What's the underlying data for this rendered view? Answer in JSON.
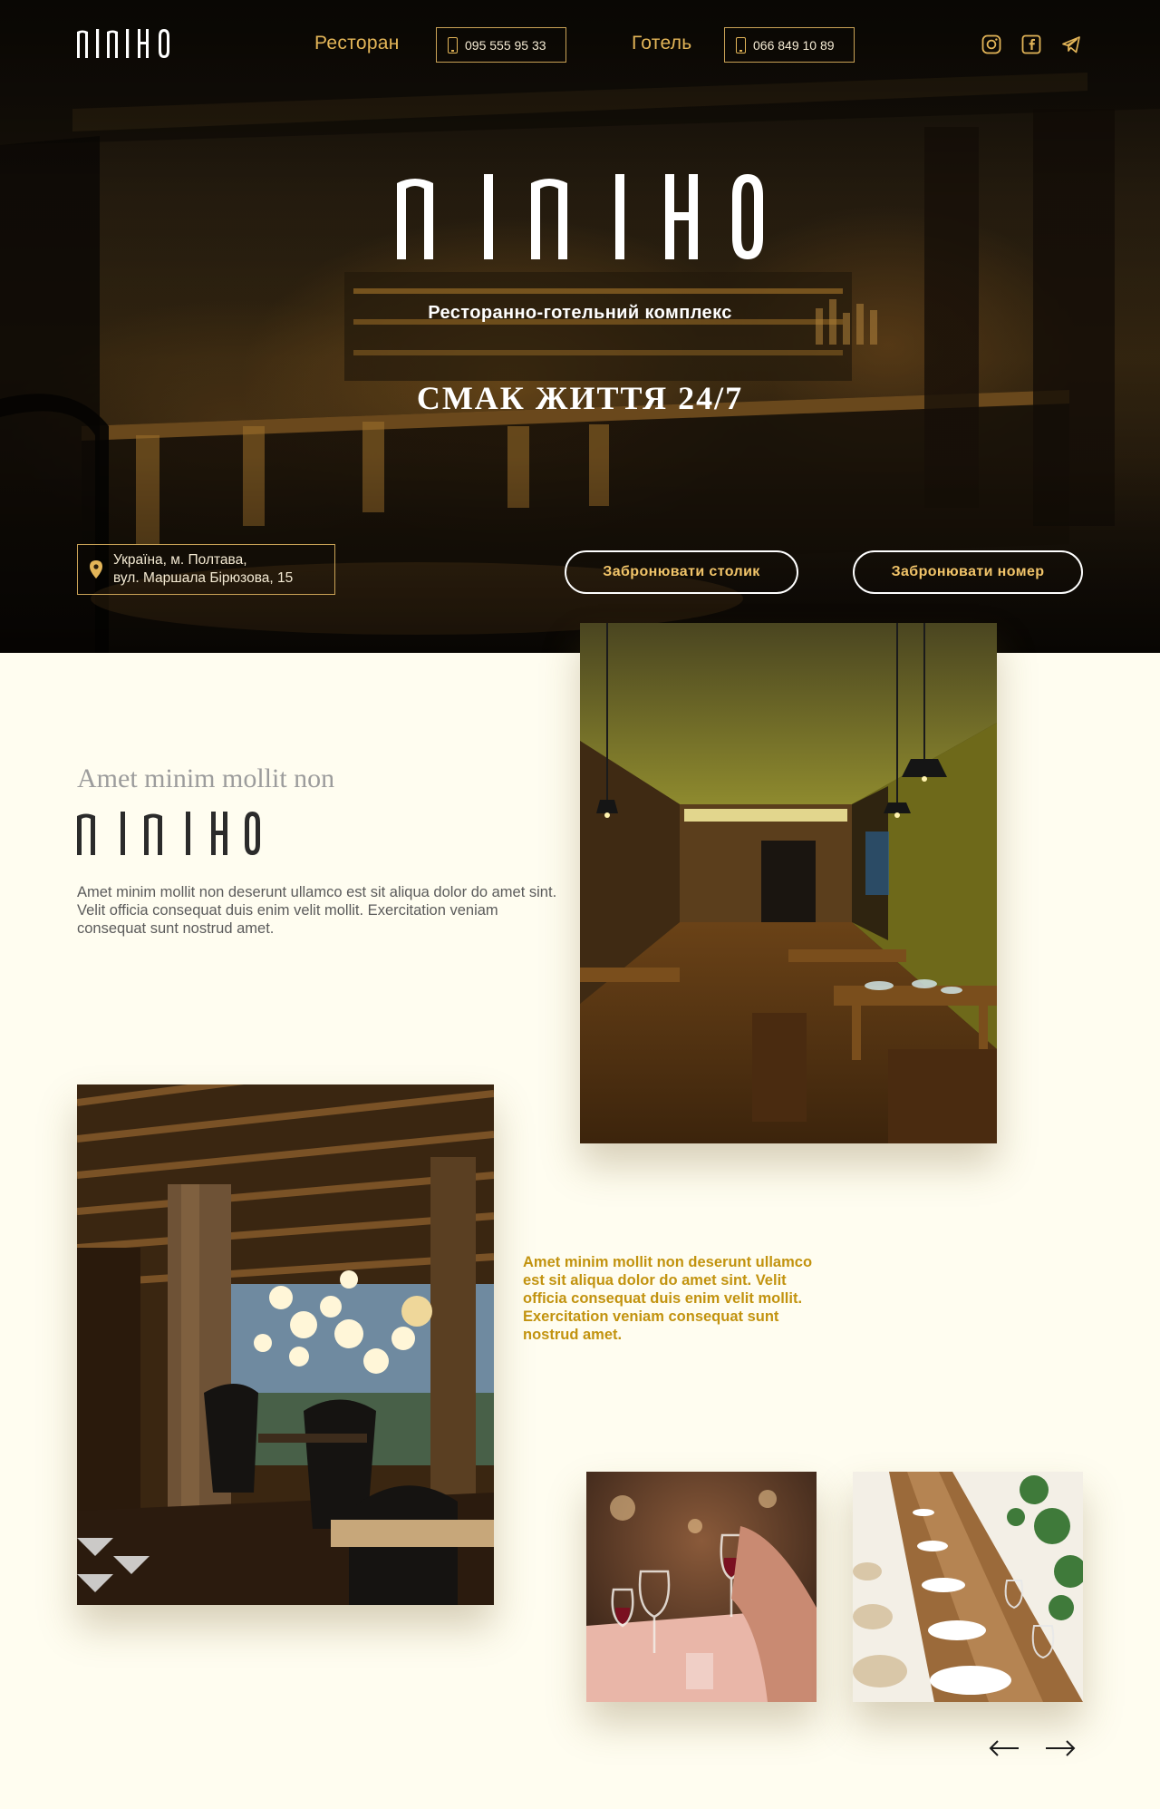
{
  "header": {
    "logo_text": "MIMIHO",
    "nav": {
      "restaurant_label": "Ресторан",
      "restaurant_phone": "095 555 95 33",
      "hotel_label": "Готель",
      "hotel_phone": "066 849 10 89"
    },
    "social_icons": [
      "instagram-icon",
      "facebook-icon",
      "telegram-icon"
    ]
  },
  "hero": {
    "logo_text": "MIMIHO",
    "subtitle": "Ресторанно-готельний комплекс",
    "title": "СМАК ЖИТТЯ 24/7",
    "address_line1": "Україна, м. Полтава,",
    "address_line2": "вул. Маршала Бірюзова, 15",
    "book_table_label": "Забронювати столик",
    "book_room_label": "Забронювати номер"
  },
  "about": {
    "kicker": "Amet minim mollit non",
    "logo_text": "MIMIHO",
    "text": "Amet minim mollit non deserunt ullamco est sit aliqua dolor do amet sint. Velit officia consequat duis enim velit mollit. Exercitation veniam consequat sunt nostrud amet.",
    "gold_text": "Amet minim mollit non deserunt ullamco est sit aliqua dolor do amet sint. Velit officia consequat duis enim velit mollit. Exercitation veniam consequat sunt nostrud amet."
  },
  "gallery": {
    "prev_icon": "arrow-left-icon",
    "next_icon": "arrow-right-icon"
  },
  "colors": {
    "accent_gold": "#e3b558",
    "button_gold": "#f1c469",
    "text_gold": "#c2930f",
    "page_background": "#fffdf0"
  }
}
